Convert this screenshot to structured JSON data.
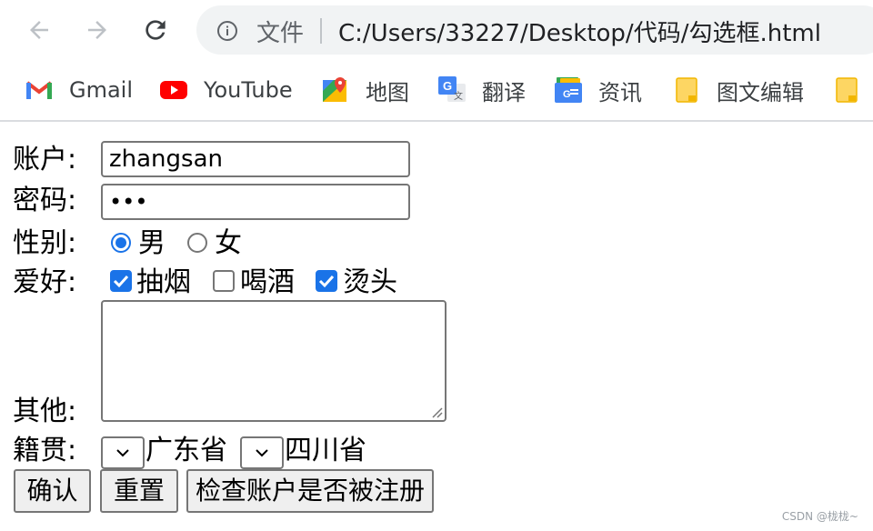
{
  "browser": {
    "omnibox": {
      "scheme_label": "文件",
      "url": "C:/Users/33227/Desktop/代码/勾选框.html"
    },
    "bookmarks": [
      {
        "label": "Gmail",
        "icon": "gmail-icon"
      },
      {
        "label": "YouTube",
        "icon": "youtube-icon"
      },
      {
        "label": "地图",
        "icon": "maps-icon"
      },
      {
        "label": "翻译",
        "icon": "translate-icon"
      },
      {
        "label": "资讯",
        "icon": "news-icon"
      },
      {
        "label": "图文编辑",
        "icon": "folder-icon"
      }
    ]
  },
  "form": {
    "account_label": "账户:",
    "account_value": "zhangsan",
    "password_label": "密码:",
    "password_value": "•••",
    "gender_label": "性别:",
    "gender_options": [
      {
        "label": "男",
        "checked": true
      },
      {
        "label": "女",
        "checked": false
      }
    ],
    "hobby_label": "爱好:",
    "hobby_options": [
      {
        "label": "抽烟",
        "checked": true
      },
      {
        "label": "喝酒",
        "checked": false
      },
      {
        "label": "烫头",
        "checked": true
      }
    ],
    "other_label": "其他:",
    "other_value": "",
    "origin_label": "籍贯:",
    "origin_selects": [
      "广东省",
      "四川省"
    ],
    "buttons": {
      "confirm": "确认",
      "reset": "重置",
      "check": "检查账户是否被注册"
    }
  },
  "watermark": "CSDN @栊栊~",
  "colors": {
    "accent": "#1a73e8",
    "omnibox_bg": "#f1f3f4",
    "button_bg": "#efefef",
    "border": "#767676"
  }
}
